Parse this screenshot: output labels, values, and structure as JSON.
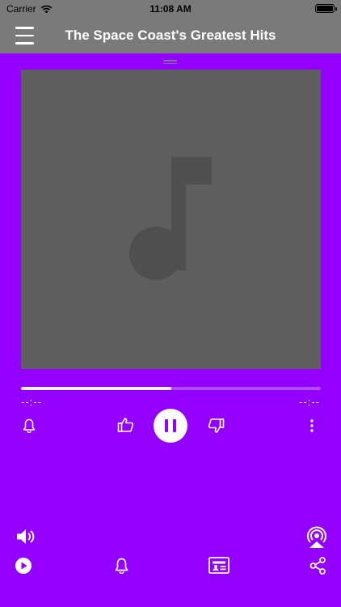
{
  "status_bar": {
    "carrier": "Carrier",
    "time": "11:08 AM",
    "icons": [
      "wifi-icon",
      "battery-icon"
    ]
  },
  "nav": {
    "title": "The Space Coast's Greatest Hits",
    "menu_icon": "hamburger-menu-icon"
  },
  "player": {
    "artwork_icon": "music-note-icon",
    "progress": 0.5,
    "elapsed": "--:--",
    "remaining": "--:--",
    "controls": [
      "bell-icon",
      "thumbs-up-icon",
      "pause-icon",
      "thumbs-down-icon",
      "more-vertical-icon"
    ]
  },
  "bottom_bar": {
    "icons": [
      "volume-icon",
      "airplay-icon",
      "play-circle-icon",
      "bell-icon",
      "contact-card-icon",
      "share-icon"
    ]
  },
  "colors": {
    "background": "#9400ff",
    "nav": "#7a7a7a",
    "artwork": "#5e5e5e",
    "note": "#4f4f4f",
    "progress_fill": "#f2f2f2",
    "progress_track": "#b24cff"
  }
}
